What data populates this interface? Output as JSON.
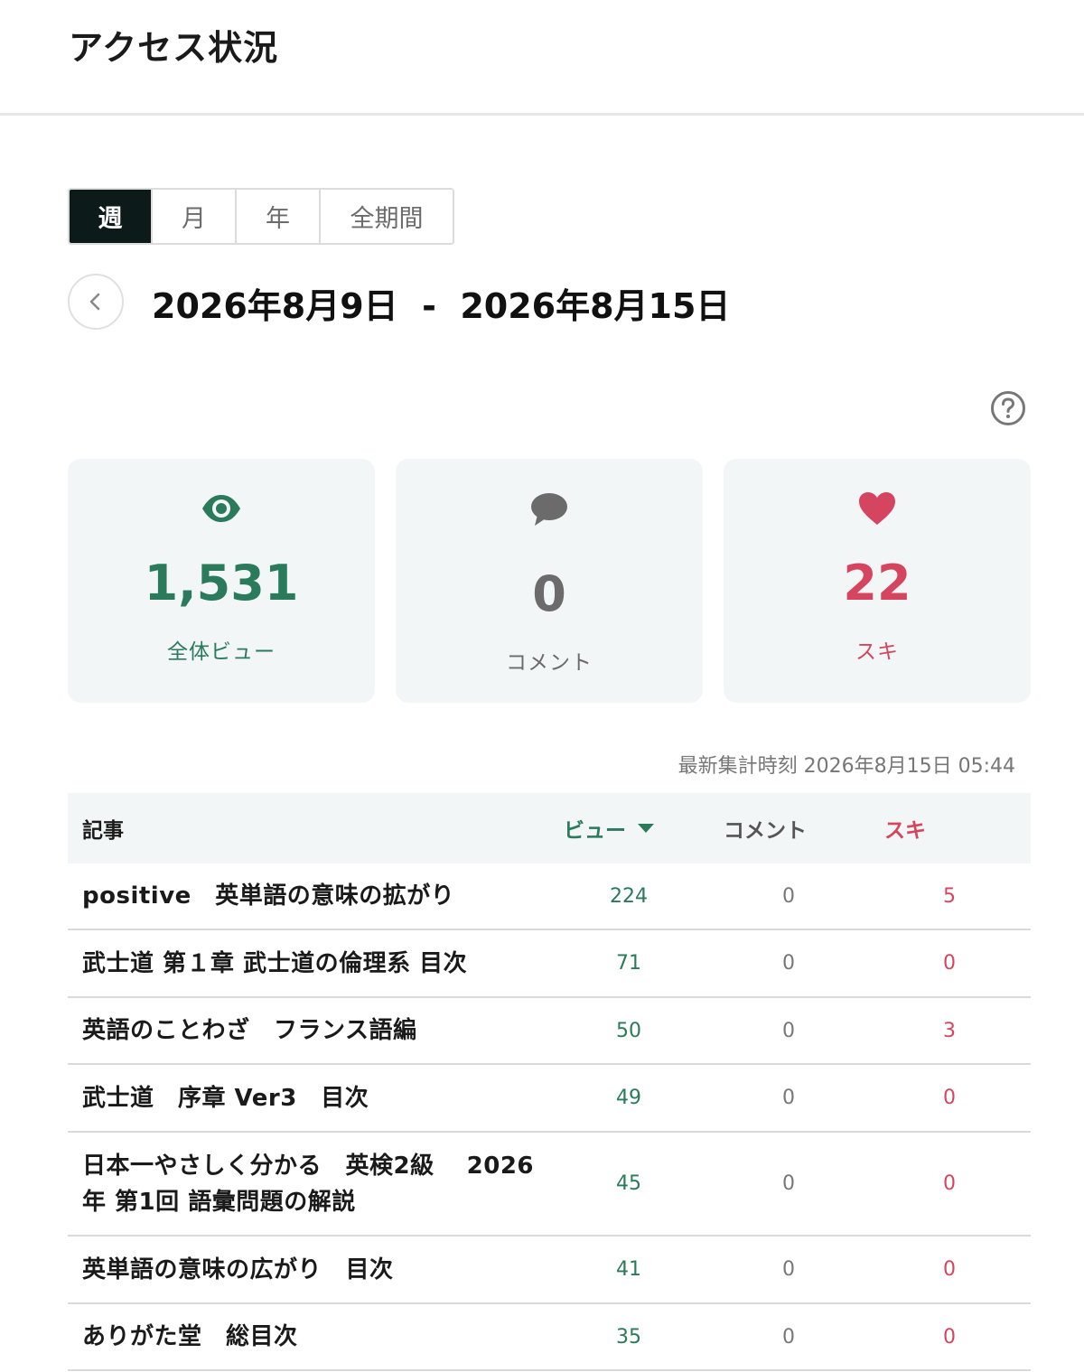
{
  "page_title": "アクセス状況",
  "period_tabs": [
    {
      "label": "週",
      "active": true
    },
    {
      "label": "月",
      "active": false
    },
    {
      "label": "年",
      "active": false
    },
    {
      "label": "全期間",
      "active": false
    }
  ],
  "date_range": "2026年8月9日  -  2026年8月15日",
  "stats": {
    "views": {
      "value": "1,531",
      "label": "全体ビュー",
      "color": "#2a7a5c",
      "icon": "eye-icon"
    },
    "comments": {
      "value": "0",
      "label": "コメント",
      "color": "#6b6b6b",
      "icon": "comment-bubble-icon"
    },
    "likes": {
      "value": "22",
      "label": "スキ",
      "color": "#d6455f",
      "icon": "heart-icon"
    }
  },
  "last_updated": "最新集計時刻 2026年8月15日 05:44",
  "table": {
    "headers": {
      "article": "記事",
      "views": "ビュー",
      "comments": "コメント",
      "likes": "スキ"
    },
    "rows": [
      {
        "title": "positive　英単語の意味の拡がり",
        "views": "224",
        "comments": "0",
        "likes": "5"
      },
      {
        "title": "武士道 第１章 武士道の倫理系 目次",
        "views": "71",
        "comments": "0",
        "likes": "0"
      },
      {
        "title": "英語のことわざ　フランス語編",
        "views": "50",
        "comments": "0",
        "likes": "3"
      },
      {
        "title": "武士道　序章 Ver3　目次",
        "views": "49",
        "comments": "0",
        "likes": "0"
      },
      {
        "title": "日本一やさしく分かる　英検2級　 2026年 第1回 語彙問題の解説",
        "views": "45",
        "comments": "0",
        "likes": "0"
      },
      {
        "title": "英単語の意味の広がり　目次",
        "views": "41",
        "comments": "0",
        "likes": "0"
      },
      {
        "title": "ありがた堂　総目次",
        "views": "35",
        "comments": "0",
        "likes": "0"
      }
    ]
  },
  "colors": {
    "views": "#2a7a5c",
    "likes": "#d6455f",
    "active_tab": "#0c1a1a"
  }
}
